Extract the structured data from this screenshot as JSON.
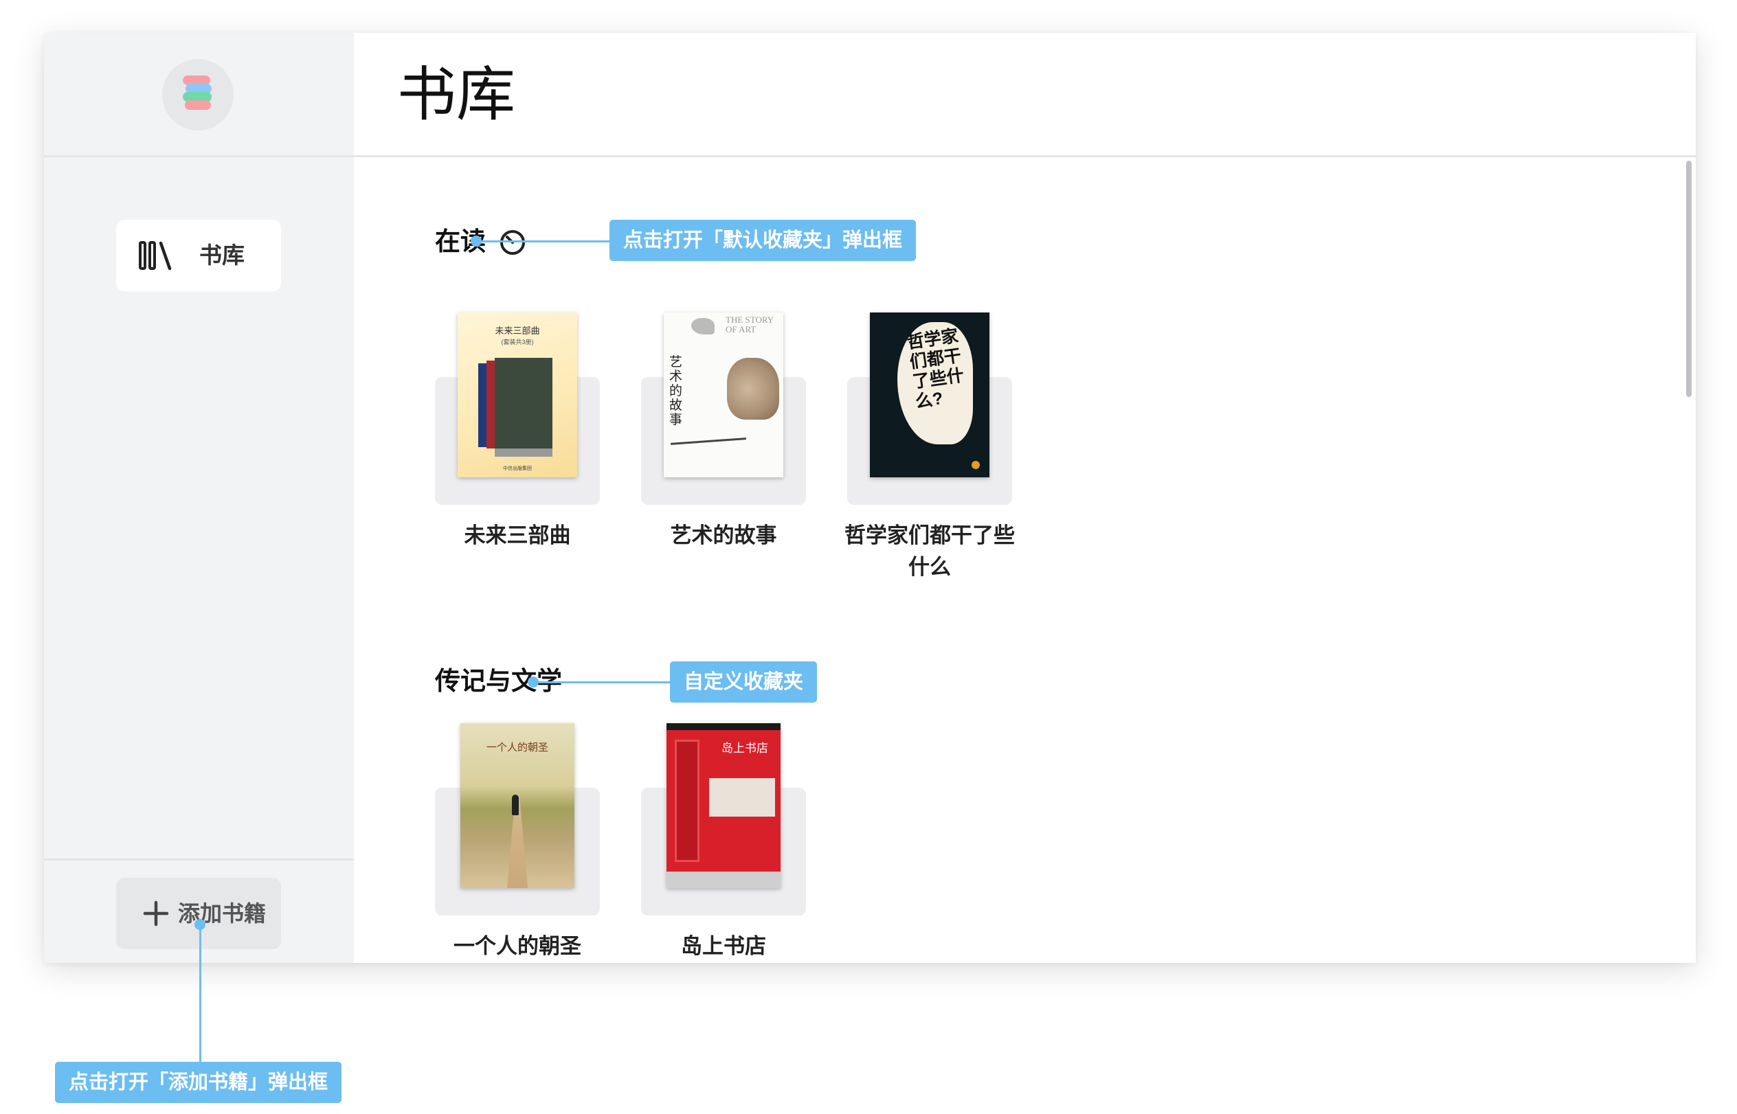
{
  "sidebar": {
    "logo": "stacked-books-logo",
    "nav": [
      {
        "label": "书库",
        "icon": "library-icon"
      }
    ],
    "add_button": {
      "label": "添加书籍",
      "icon": "plus-icon"
    }
  },
  "main": {
    "title": "书库",
    "sections": [
      {
        "title": "在读",
        "icon": "clock-icon",
        "books": [
          {
            "title": "未来三部曲",
            "cover_text": "未来三部曲",
            "cover_sub": "(套装共3册)"
          },
          {
            "title": "艺术的故事",
            "cover_text": "艺术的故事",
            "cover_sub": "THE STORY OF ART"
          },
          {
            "title": "哲学家们都干了些什么",
            "cover_text": "哲学家们都干了些什么?"
          }
        ]
      },
      {
        "title": "传记与文学",
        "books": [
          {
            "title": "一个人的朝圣",
            "cover_text": "一个人的朝圣"
          },
          {
            "title": "岛上书店",
            "cover_text": "岛上书店"
          }
        ]
      }
    ]
  },
  "annotations": {
    "reading": "点击打开「默认收藏夹」弹出框",
    "custom": "自定义收藏夹",
    "add_book": "点击打开「添加书籍」弹出框"
  },
  "colors": {
    "accent": "#6cbdf1",
    "sidebar_bg": "#f2f3f5",
    "shelf": "#ededef"
  }
}
